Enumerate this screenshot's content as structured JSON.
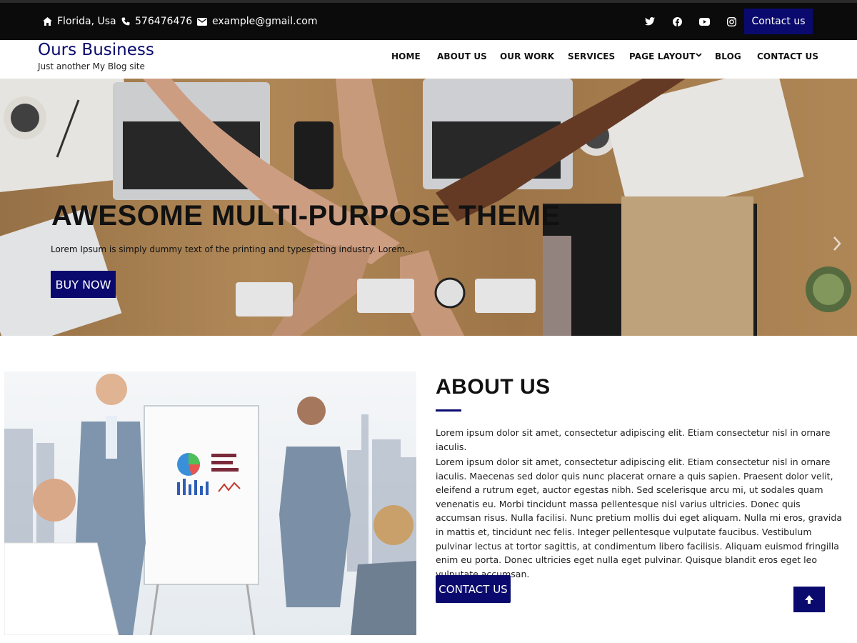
{
  "topbar": {
    "location": "Florida, Usa",
    "phone": "576476476",
    "email": "example@gmail.com",
    "social_icons": [
      "twitter-icon",
      "facebook-icon",
      "youtube-icon",
      "instagram-icon"
    ],
    "contact_label": "Contact us"
  },
  "header": {
    "brand": "Ours Business",
    "tagline": "Just another My Blog site",
    "nav": {
      "home": "HOME",
      "about": "ABOUT US",
      "work": "OUR WORK",
      "services": "SERVICES",
      "layout": "PAGE LAYOUT",
      "blog": "BLOG",
      "contact": "CONTACT US"
    }
  },
  "hero": {
    "title": "AWESOME MULTI-PURPOSE THEME",
    "subtitle": "Lorem Ipsum is simply dummy text of the printing and typesetting industry. Lorem...",
    "button": "BUY NOW"
  },
  "about": {
    "title": "ABOUT US",
    "p1": "Lorem ipsum dolor sit amet, consectetur adipiscing elit. Etiam consectetur nisl in ornare iaculis.",
    "p2": "Lorem ipsum dolor sit amet, consectetur adipiscing elit. Etiam consectetur nisl in ornare iaculis. Maecenas sed dolor quis nunc placerat ornare a quis sapien. Praesent dolor velit, eleifend a rutrum eget, auctor egestas nibh. Sed scelerisque arcu mi, ut sodales quam venenatis eu. Morbi tincidunt massa pellentesque nisl varius ultricies. Donec quis accumsan risus. Nulla facilisi. Nunc pretium mollis dui eget aliquam. Nulla mi eros, gravida in mattis et, tincidunt nec felis. Integer pellentesque vulputate faucibus. Vestibulum pulvinar lectus at tortor sagittis, at condimentum libero facilisis. Aliquam euismod fringilla enim eu porta. Donec ultricies eget nulla eget pulvinar. Quisque blandit eros eget leo vulputate accumsan.",
    "button": "CONTACT US"
  },
  "colors": {
    "accent": "#0a0a6e",
    "topbar": "#0b0b0b"
  }
}
